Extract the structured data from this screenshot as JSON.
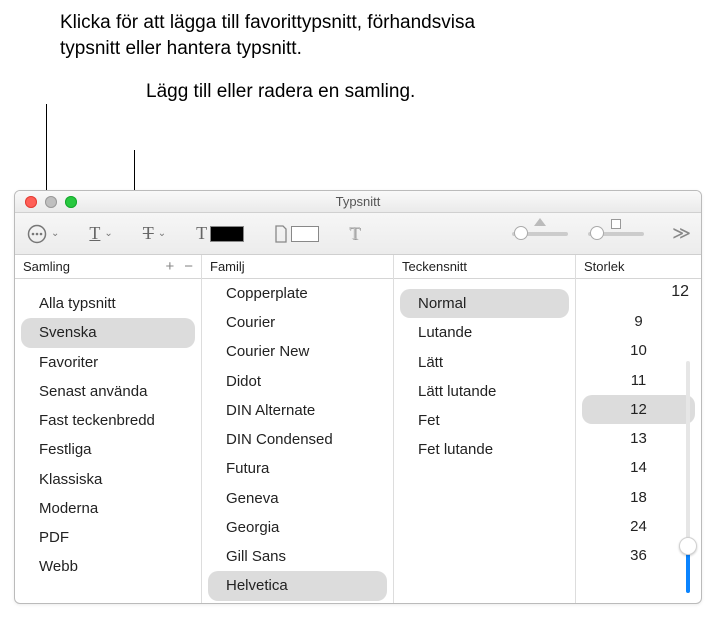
{
  "callouts": {
    "top": "Klicka för att lägga till favorittypsnitt, förhandsvisa typsnitt eller hantera typsnitt.",
    "second": "Lägg till eller radera en samling."
  },
  "window": {
    "title": "Typsnitt"
  },
  "headers": {
    "samling": "Samling",
    "familj": "Familj",
    "teckensnitt": "Teckensnitt",
    "storlek": "Storlek"
  },
  "samling": {
    "items": [
      {
        "label": "Alla typsnitt",
        "selected": false
      },
      {
        "label": "Svenska",
        "selected": true
      },
      {
        "label": "Favoriter",
        "selected": false
      },
      {
        "label": "Senast använda",
        "selected": false
      },
      {
        "label": "Fast teckenbredd",
        "selected": false
      },
      {
        "label": "Festliga",
        "selected": false
      },
      {
        "label": "Klassiska",
        "selected": false
      },
      {
        "label": "Moderna",
        "selected": false
      },
      {
        "label": "PDF",
        "selected": false
      },
      {
        "label": "Webb",
        "selected": false
      }
    ]
  },
  "familj": {
    "items": [
      {
        "label": "Copperplate",
        "selected": false
      },
      {
        "label": "Courier",
        "selected": false
      },
      {
        "label": "Courier New",
        "selected": false
      },
      {
        "label": "Didot",
        "selected": false
      },
      {
        "label": "DIN Alternate",
        "selected": false
      },
      {
        "label": "DIN Condensed",
        "selected": false
      },
      {
        "label": "Futura",
        "selected": false
      },
      {
        "label": "Geneva",
        "selected": false
      },
      {
        "label": "Georgia",
        "selected": false
      },
      {
        "label": "Gill Sans",
        "selected": false
      },
      {
        "label": "Helvetica",
        "selected": true
      }
    ]
  },
  "teckensnitt": {
    "items": [
      {
        "label": "Normal",
        "selected": true
      },
      {
        "label": "Lutande",
        "selected": false
      },
      {
        "label": "Lätt",
        "selected": false
      },
      {
        "label": "Lätt lutande",
        "selected": false
      },
      {
        "label": "Fet",
        "selected": false
      },
      {
        "label": "Fet lutande",
        "selected": false
      }
    ]
  },
  "storlek": {
    "value": "12",
    "items": [
      {
        "label": "9",
        "selected": false
      },
      {
        "label": "10",
        "selected": false
      },
      {
        "label": "11",
        "selected": false
      },
      {
        "label": "12",
        "selected": true
      },
      {
        "label": "13",
        "selected": false
      },
      {
        "label": "14",
        "selected": false
      },
      {
        "label": "18",
        "selected": false
      },
      {
        "label": "24",
        "selected": false
      },
      {
        "label": "36",
        "selected": false
      }
    ]
  },
  "icons": {
    "more": "more-options-icon",
    "underline": "underline-icon",
    "strike": "strikethrough-icon",
    "textcolor": "text-color-icon",
    "doccolor": "document-color-icon",
    "shadow": "text-shadow-icon",
    "expand": "expand-icon",
    "plus": "+",
    "minus": "−"
  }
}
